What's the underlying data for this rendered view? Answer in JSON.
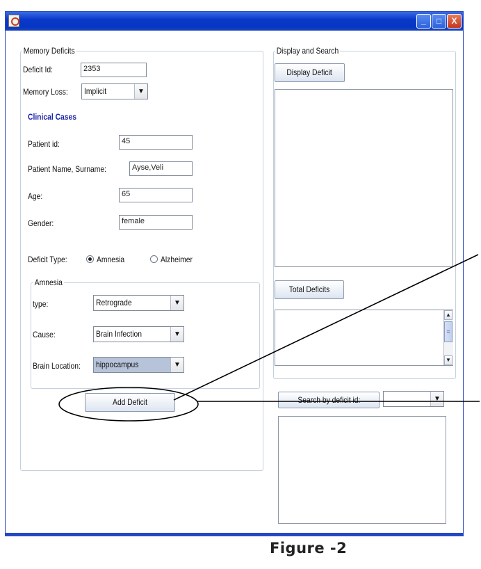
{
  "window": {
    "icon": "java-cup-icon",
    "controls": {
      "minimize": "_",
      "maximize": "□",
      "close": "X"
    }
  },
  "memory_deficits": {
    "legend": "Memory Deficits",
    "deficit_id_label": "Deficit Id:",
    "deficit_id_value": "2353",
    "memory_loss_label": "Memory Loss:",
    "memory_loss_value": "Implicit",
    "clinical_cases_label": "Clinical Cases",
    "patient_id_label": "Patient id:",
    "patient_id_value": "45",
    "patient_name_label": "Patient Name, Surname:",
    "patient_name_value": "Ayse,Veli",
    "age_label": "Age:",
    "age_value": "65",
    "gender_label": "Gender:",
    "gender_value": "female",
    "deficit_type_label": "Deficit Type:",
    "deficit_type_options": [
      "Amnesia",
      "Alzheimer"
    ],
    "deficit_type_selected": "Amnesia",
    "amnesia": {
      "legend": "Amnesia",
      "type_label": "type:",
      "type_value": "Retrograde",
      "cause_label": "Cause:",
      "cause_value": "Brain Infection",
      "location_label": "Brain Location:",
      "location_value": "hippocampus"
    },
    "add_button": "Add Deficit"
  },
  "display_search": {
    "legend": "Display and Search",
    "display_button": "Display Deficit",
    "total_button": "Total Deficits",
    "search_button": "Search by deficit id:",
    "search_combo_value": ""
  },
  "caption": "Figure -2",
  "colors": {
    "titlebar": "#0535c2",
    "accent_blue": "#1b24a8"
  }
}
